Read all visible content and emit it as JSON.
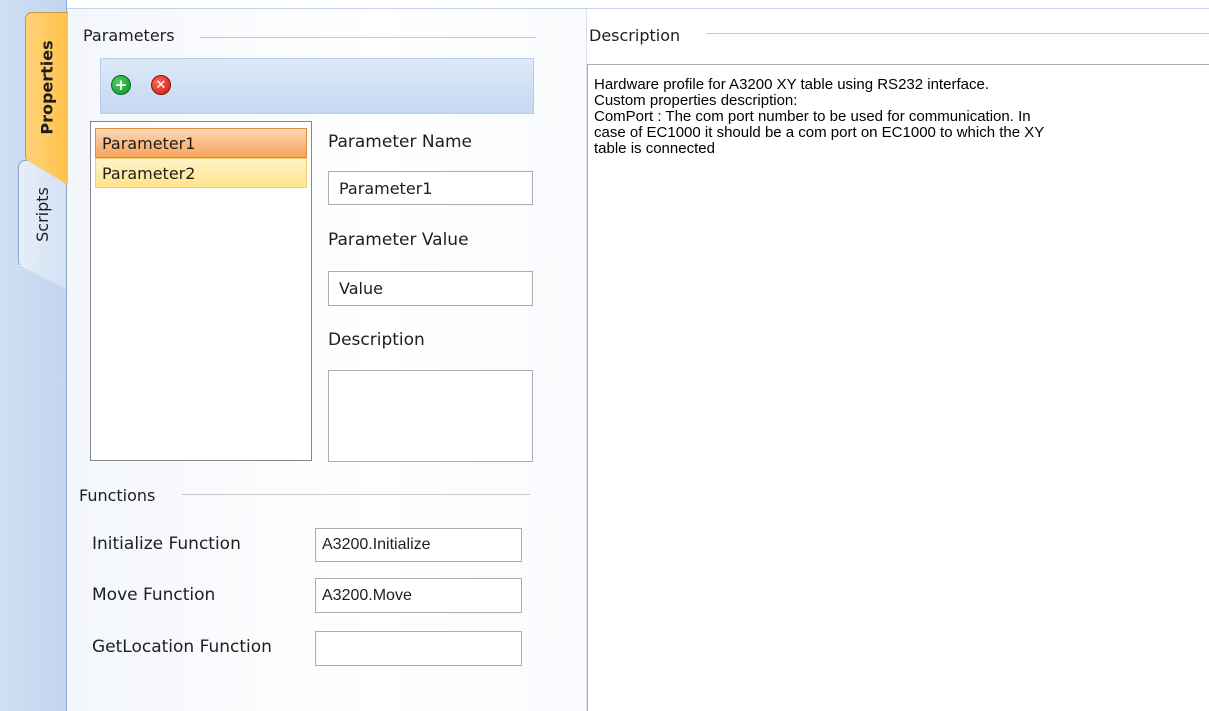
{
  "tabs": [
    {
      "label": "Properties",
      "selected": true
    },
    {
      "label": "Scripts",
      "selected": false
    }
  ],
  "parameters": {
    "group_title": "Parameters",
    "toolbar": {
      "add_icon": "add-circle-icon",
      "remove_icon": "remove-circle-icon"
    },
    "items": [
      {
        "label": "Parameter1",
        "state": "selected"
      },
      {
        "label": "Parameter2",
        "state": "hover"
      }
    ],
    "name_label": "Parameter Name",
    "name_value": "Parameter1",
    "value_label": "Parameter Value",
    "value_value": "Value",
    "description_label": "Description",
    "description_value": ""
  },
  "functions": {
    "group_title": "Functions",
    "initialize_label": "Initialize Function",
    "initialize_value": "A3200.Initialize",
    "move_label": "Move Function",
    "move_value": "A3200.Move",
    "getlocation_label": "GetLocation Function",
    "getlocation_value": ""
  },
  "description": {
    "group_title": "Description",
    "lines": [
      "Hardware profile for A3200 XY table using RS232 interface.",
      "Custom properties description:",
      "ComPort : The com port number to be used for communication. In",
      "case of EC1000 it should be a com port on EC1000 to which the XY",
      "table is connected"
    ]
  },
  "colors": {
    "selected_tab": "#ffc24a",
    "selected_item": "#f7a35c",
    "hover_item": "#ffe48a",
    "toolbar": "#c4d8f1"
  }
}
